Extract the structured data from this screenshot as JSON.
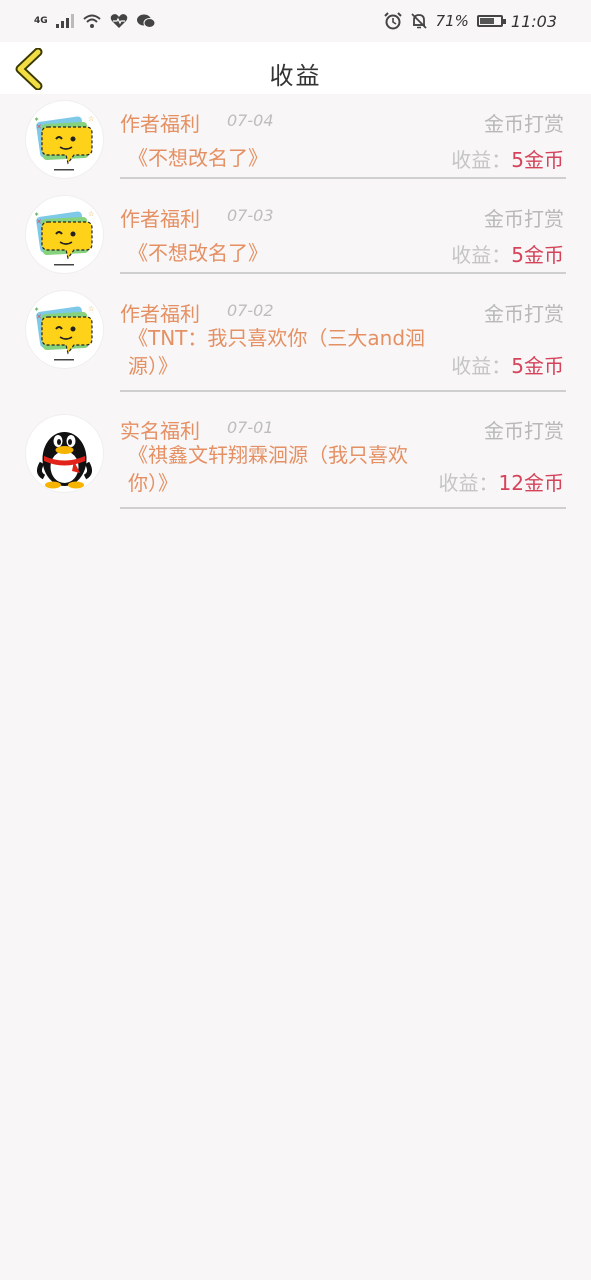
{
  "status_bar": {
    "network": "4G",
    "battery_percent": "71%",
    "battery_level": 0.71,
    "time": "11:03"
  },
  "header": {
    "title": "收益"
  },
  "list": [
    {
      "avatar": "emoji-chat-bubble",
      "type": "作者福利",
      "date": "07-04",
      "kind": "金币打赏",
      "book": "《不想改名了》",
      "earn_label": "收益：",
      "earn_value": "5金币"
    },
    {
      "avatar": "emoji-chat-bubble",
      "type": "作者福利",
      "date": "07-03",
      "kind": "金币打赏",
      "book": "《不想改名了》",
      "earn_label": "收益：",
      "earn_value": "5金币"
    },
    {
      "avatar": "emoji-chat-bubble",
      "type": "作者福利",
      "date": "07-02",
      "kind": "金币打赏",
      "book": "《TNT：我只喜欢你（三大and洄源）》",
      "earn_label": "收益：",
      "earn_value": "5金币"
    },
    {
      "avatar": "qq-penguin",
      "type": "实名福利",
      "date": "07-01",
      "kind": "金币打赏",
      "book": "《祺鑫文轩翔霖洄源（我只喜欢你）》",
      "earn_label": "收益：",
      "earn_value": "12金币"
    }
  ],
  "colors": {
    "accent_orange": "#e59063",
    "earn_red": "#d5435a",
    "muted_gray": "#b8b8b8",
    "background": "#f8f6f7"
  }
}
